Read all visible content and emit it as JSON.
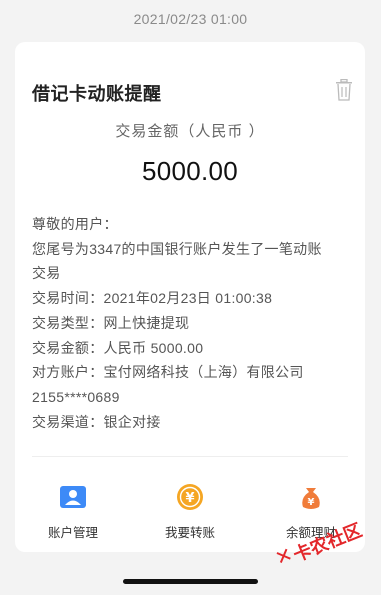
{
  "timestamp": "2021/02/23 01:00",
  "card": {
    "title": "借记卡动账提醒",
    "amount_label": "交易金额（人民币 ）",
    "amount": "5000.00",
    "lines": [
      "尊敬的用户：",
      "您尾号为3347的中国银行账户发生了一笔动账",
      "交易",
      "交易时间：2021年02月23日 01:00:38",
      "交易类型：网上快捷提现",
      "交易金额：人民币 5000.00",
      "对方账户：宝付网络科技（上海）有限公司",
      "2155****0689",
      "交易渠道：银企对接"
    ],
    "actions": [
      {
        "label": "账户管理",
        "icon": "account-icon"
      },
      {
        "label": "我要转账",
        "icon": "transfer-icon"
      },
      {
        "label": "余额理财",
        "icon": "wealth-icon"
      }
    ]
  },
  "watermark": {
    "text": "卡农社区"
  },
  "colors": {
    "accent_blue": "#3d8af7",
    "accent_orange": "#f5a623",
    "watermark_red": "#e3272b"
  }
}
